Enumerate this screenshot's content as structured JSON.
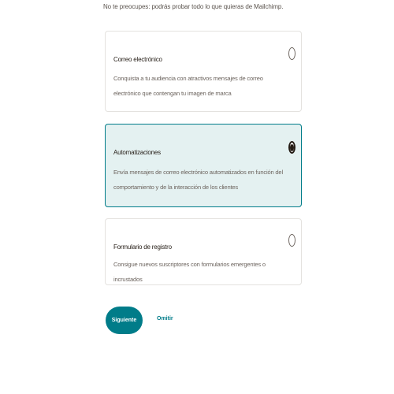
{
  "intro_text": "No te preocupes: podrás probar todo lo que quieras de Mailchimp.",
  "options": [
    {
      "title": "Correo electrónico",
      "description": "Conquista a tu audiencia con atractivos mensajes de correo electrónico que contengan tu imagen de marca",
      "selected": false
    },
    {
      "title": "Automatizaciones",
      "description": "Envía mensajes de correo electrónico automatizados en función del comportamiento y de la interacción de los clientes",
      "selected": true
    },
    {
      "title": "Formulario de registro",
      "description": "Consigue nuevos suscriptores con formularios emergentes o incrustados",
      "selected": false
    }
  ],
  "actions": {
    "next_label": "Siguiente",
    "skip_label": "Omitir"
  },
  "colors": {
    "accent": "#007c89",
    "selected_bg": "#e4f1f1",
    "text": "#241c15",
    "muted": "#6e6660"
  }
}
